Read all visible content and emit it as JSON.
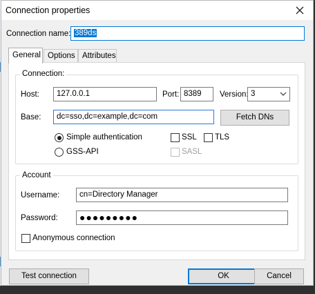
{
  "window": {
    "title": "Connection properties"
  },
  "connection_name": {
    "label": "Connection name:",
    "value": "389ds"
  },
  "tabs": [
    {
      "label": "General",
      "active": true
    },
    {
      "label": "Options",
      "active": false
    },
    {
      "label": "Attributes",
      "active": false
    }
  ],
  "connection_group": {
    "title": "Connection:",
    "host": {
      "label": "Host:",
      "value": "127.0.0.1"
    },
    "port": {
      "label": "Port:",
      "value": "8389"
    },
    "version": {
      "label": "Version:",
      "value": "3"
    },
    "base": {
      "label": "Base:",
      "value": "dc=sso,dc=example,dc=com"
    },
    "fetch_dns_label": "Fetch DNs",
    "auth": {
      "simple_label": "Simple authentication",
      "gss_label": "GSS-API",
      "selected": "simple"
    },
    "ssl": {
      "label": "SSL",
      "checked": false
    },
    "tls": {
      "label": "TLS",
      "checked": false
    },
    "sasl": {
      "label": "SASL",
      "checked": false,
      "enabled": false
    }
  },
  "account_group": {
    "title": "Account",
    "username": {
      "label": "Username:",
      "value": "cn=Directory Manager"
    },
    "password": {
      "label": "Password:",
      "value": "●●●●●●●●●"
    },
    "anonymous": {
      "label": "Anonymous connection",
      "checked": false
    }
  },
  "buttons": {
    "test_label": "Test connection",
    "ok_label": "OK",
    "cancel_label": "Cancel"
  },
  "colors": {
    "accent": "#0078d7",
    "dialog_bg": "#f0f0f0",
    "panel_bg": "#ffffff"
  },
  "icons": {
    "close": "close-icon",
    "dropdown": "chevron-down-icon"
  }
}
